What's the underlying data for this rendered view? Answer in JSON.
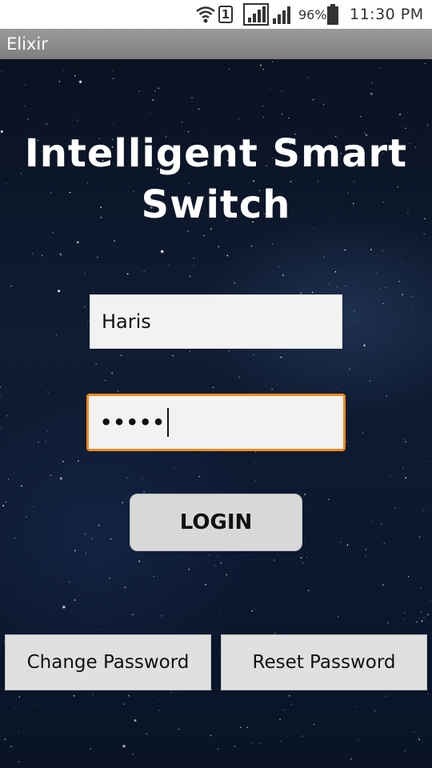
{
  "status_bar": {
    "sim_slot": "1",
    "battery_percent": "96%",
    "time": "11:30 PM",
    "icons": [
      "wifi-icon",
      "sim-icon",
      "signal-icon",
      "signal-icon",
      "battery-icon"
    ]
  },
  "title_bar": {
    "app_name": "Elixir"
  },
  "main": {
    "title_line1": "Intelligent Smart",
    "title_line2": "Switch",
    "username_value": "Haris",
    "password_masked": "•••••",
    "login_label": "LOGIN",
    "change_password_label": "Change Password",
    "reset_password_label": "Reset Password"
  },
  "colors": {
    "focus_border": "#f0891a",
    "title_bar_bg": "#8a8a8a",
    "button_bg": "#d8d8d8"
  }
}
